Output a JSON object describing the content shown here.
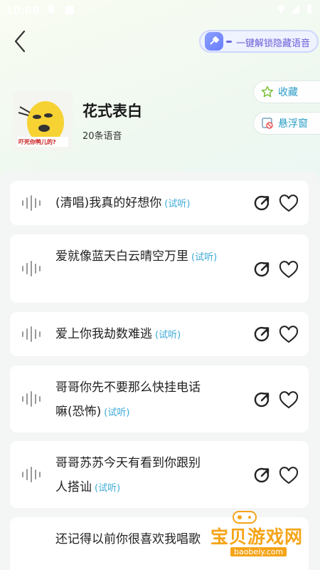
{
  "status_bar": {
    "time": "10:00"
  },
  "header": {
    "unlock_label": "一键解锁隐藏语音"
  },
  "album": {
    "cover_caption": "吓死你鸭儿的?",
    "title": "花式表白",
    "count": "20条语音"
  },
  "actions": {
    "favorite_label": "收藏",
    "float_label": "悬浮窗"
  },
  "tracks": [
    {
      "line1": "(清唱)我真的好想你",
      "line2": "",
      "trial": "(试听)"
    },
    {
      "line1": "爱就像蓝天白云晴空万里",
      "line2": "",
      "trial": "(试听)"
    },
    {
      "line1": "爱上你我劫数难逃",
      "line2": "",
      "trial": "(试听)"
    },
    {
      "line1": "哥哥你先不要那么快挂电话",
      "line2": "嘛(恐怖)",
      "trial": "(试听)"
    },
    {
      "line1": "哥哥苏苏今天有看到你跟别",
      "line2": "人搭讪",
      "trial": "(试听)"
    },
    {
      "line1": "还记得以前你很喜欢我唱歌",
      "line2": "",
      "trial": ""
    }
  ],
  "watermark": {
    "brand": "宝贝游戏网",
    "url": "baobeiy.com"
  },
  "colors": {
    "accent": "#3aa9d8",
    "unlock_text": "#6a5bd8",
    "watermark": "#f5a418"
  }
}
